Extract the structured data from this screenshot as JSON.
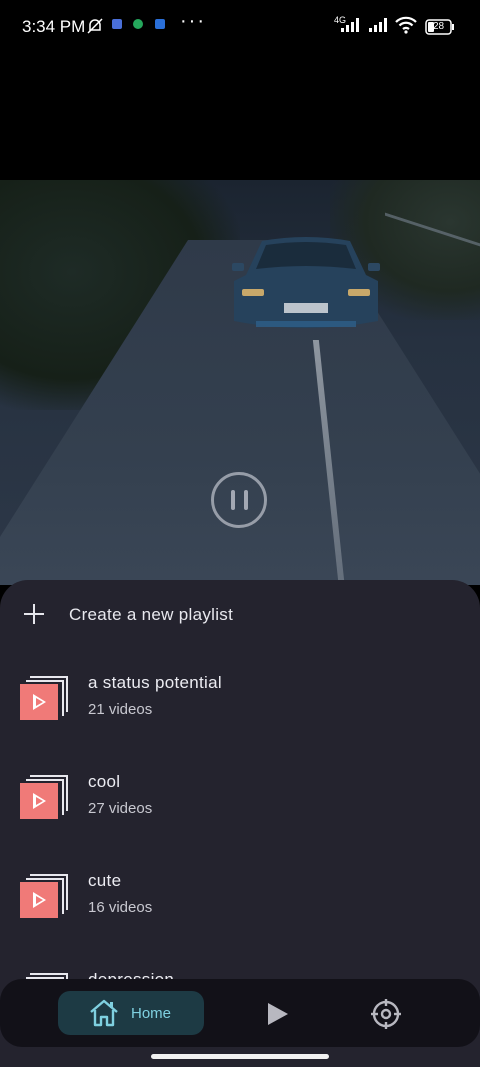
{
  "status_bar": {
    "time": "3:34 PM",
    "network": "4G",
    "battery": "28",
    "icons": [
      "mute-icon",
      "notification-icon",
      "whatsapp-icon",
      "phone-app-icon",
      "more-dots",
      "signal-icon",
      "wifi-icon",
      "battery-icon"
    ]
  },
  "video": {
    "state": "playing",
    "overlay_icon": "pause-icon"
  },
  "sheet": {
    "create_label": "Create a new playlist",
    "playlists": [
      {
        "name": "a status potential",
        "count": "21 videos"
      },
      {
        "name": "cool",
        "count": "27 videos"
      },
      {
        "name": "cute",
        "count": "16 videos"
      },
      {
        "name": "depression",
        "count": ""
      }
    ]
  },
  "nav": {
    "home_label": "Home",
    "active": "home",
    "items": [
      "home-icon",
      "play-icon",
      "settings-icon"
    ]
  },
  "colors": {
    "accent": "#7fd0e0",
    "sheet_bg": "#24232e",
    "thumb": "#f07a78",
    "nav_bg": "#121118",
    "nav_active_bg": "#1d3a44"
  }
}
